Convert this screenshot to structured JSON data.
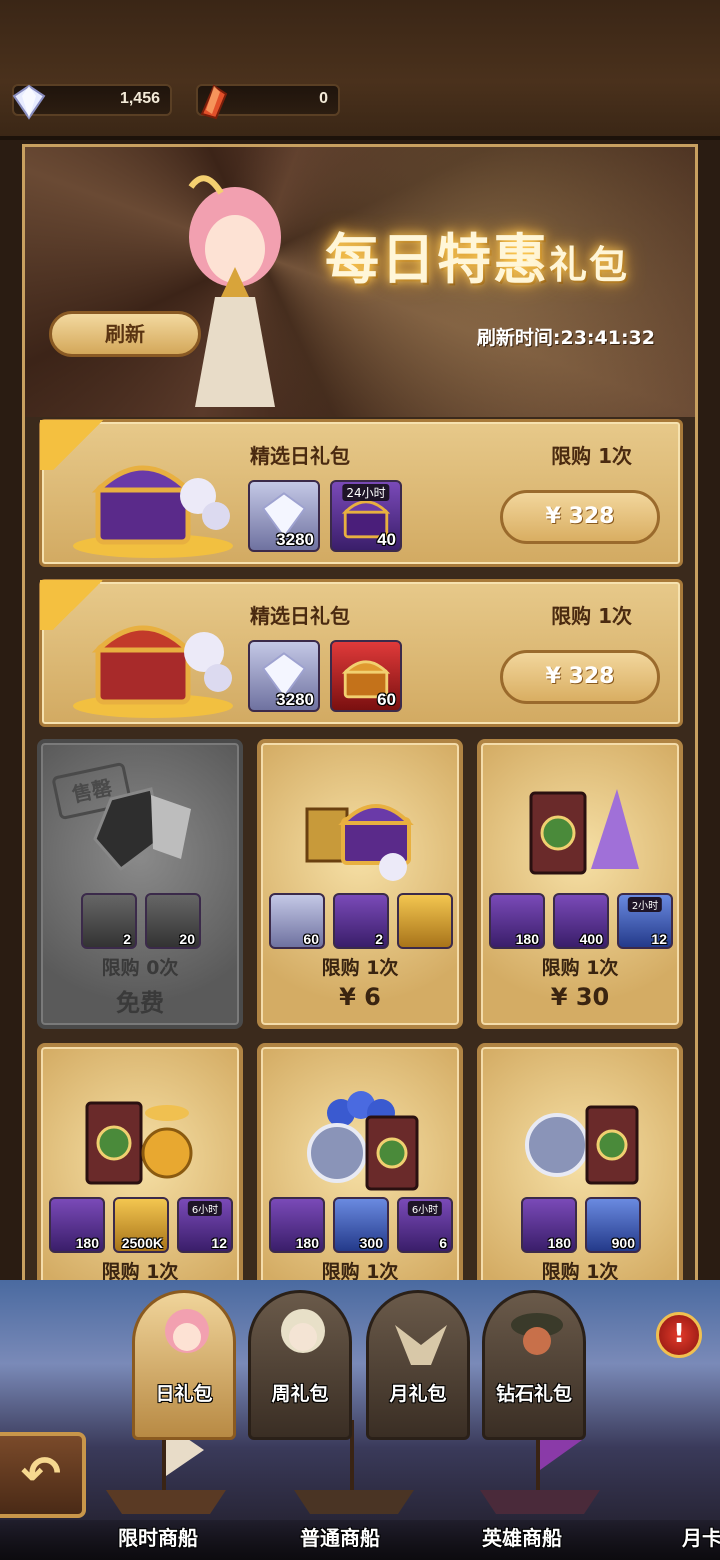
{
  "currencies": {
    "diamond": {
      "icon": "diamond-icon",
      "value": "1,456"
    },
    "crystal": {
      "icon": "red-crystal-icon",
      "value": "0"
    }
  },
  "banner": {
    "title_main": "每日特惠",
    "title_small": "礼包",
    "refresh_label": "刷新",
    "refresh_time": "刷新时间:23:41:32"
  },
  "wide_packs": [
    {
      "name": "精选日礼包",
      "limit": "限购 1次",
      "price": "¥ 328",
      "items": [
        {
          "icon": "diamond-icon",
          "qty": "3280",
          "tag": ""
        },
        {
          "icon": "purple-chest-icon",
          "qty": "40",
          "tag": "24小时"
        }
      ]
    },
    {
      "name": "精选日礼包",
      "limit": "限购 1次",
      "price": "¥ 328",
      "items": [
        {
          "icon": "diamond-icon",
          "qty": "3280",
          "tag": ""
        },
        {
          "icon": "red-chest-icon",
          "qty": "60",
          "tag": ""
        }
      ]
    }
  ],
  "card_packs": [
    {
      "soldout": true,
      "stamp": "售罄",
      "limit": "限购 0次",
      "price": "免费",
      "items": [
        {
          "icon": "shard-icon",
          "qty": "2",
          "tag": ""
        },
        {
          "icon": "diamond-icon",
          "qty": "20",
          "tag": ""
        }
      ]
    },
    {
      "soldout": false,
      "limit": "限购 1次",
      "price": "¥ 6",
      "items": [
        {
          "icon": "diamond-icon",
          "qty": "60",
          "tag": ""
        },
        {
          "icon": "hero-card-icon",
          "qty": "2",
          "tag": ""
        },
        {
          "icon": "gold-chest-icon",
          "qty": "",
          "tag": ""
        }
      ]
    },
    {
      "soldout": false,
      "limit": "限购 1次",
      "price": "¥ 30",
      "items": [
        {
          "icon": "scroll-card-icon",
          "qty": "180",
          "tag": ""
        },
        {
          "icon": "purple-dust-icon",
          "qty": "400",
          "tag": ""
        },
        {
          "icon": "potion-icon",
          "qty": "12",
          "tag": "2小时"
        }
      ]
    },
    {
      "soldout": false,
      "limit": "限购 1次",
      "price": "",
      "items": [
        {
          "icon": "scroll-card-icon",
          "qty": "180",
          "tag": ""
        },
        {
          "icon": "gold-coin-icon",
          "qty": "2500K",
          "tag": ""
        },
        {
          "icon": "coins-pile-icon",
          "qty": "12",
          "tag": "6小时"
        }
      ]
    },
    {
      "soldout": false,
      "limit": "限购 1次",
      "price": "",
      "items": [
        {
          "icon": "scroll-card-icon",
          "qty": "180",
          "tag": ""
        },
        {
          "icon": "hammer-coin-icon",
          "qty": "300",
          "tag": ""
        },
        {
          "icon": "blue-orbs-icon",
          "qty": "6",
          "tag": "6小时"
        }
      ]
    },
    {
      "soldout": false,
      "limit": "限购 1次",
      "price": "",
      "items": [
        {
          "icon": "scroll-card-icon",
          "qty": "180",
          "tag": ""
        },
        {
          "icon": "hammer-coin-icon",
          "qty": "900",
          "tag": ""
        }
      ]
    }
  ],
  "tabs": [
    {
      "label": "日礼包",
      "active": true
    },
    {
      "label": "周礼包",
      "active": false
    },
    {
      "label": "月礼包",
      "active": false
    },
    {
      "label": "钻石礼包",
      "active": false
    }
  ],
  "alert_glyph": "!",
  "back_glyph": "↶",
  "dock": [
    {
      "label": "限时商船"
    },
    {
      "label": "普通商船"
    },
    {
      "label": "英雄商船"
    },
    {
      "label": "月卡"
    }
  ],
  "colors": {
    "frame_gold": "#c8a060",
    "card_gold": "#d4ac64",
    "text_brown": "#3a2410",
    "accent_purple": "#7a4ab8"
  }
}
